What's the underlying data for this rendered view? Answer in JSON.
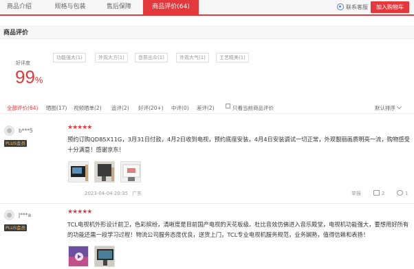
{
  "tabs": [
    {
      "label": "商品介绍"
    },
    {
      "label": "规格与包装"
    },
    {
      "label": "售后保障"
    },
    {
      "label": "商品评价(64)"
    }
  ],
  "header": {
    "service_label": "联系客服",
    "cart_label": "加入购物车"
  },
  "section_title": "商品评价",
  "rating": {
    "label": "好评度",
    "value": "99",
    "unit": "%"
  },
  "tags": [
    "功能强大(1)",
    "外观大方(1)",
    "音质出众(1)",
    "外观大气(1)",
    "工艺精美(1)"
  ],
  "filters": [
    "全部评价(64)",
    "晒图(17)",
    "视频晒单(2)",
    "追评(2)",
    "好评(20+)",
    "中评(0)",
    "差评(2)"
  ],
  "only_current_label": "只看当前商品评价",
  "sort_label": "默认排序",
  "reviews": [
    {
      "user": "b***5",
      "badge": "PLUS会员",
      "stars": "★★★★★",
      "text": "预约订购QD85X11G，3月31日付款，4月2日收到电视，预约底座安装，4月4日安装调试一切正常，外观靓丽画质明亮一流，购物感受十分满意！感谢京东！",
      "time": "2023-04-04 20:35",
      "location": "广东",
      "report_label": "举报",
      "likes": "2",
      "comments": "1"
    },
    {
      "user": "J***a",
      "badge": "PLUS会员",
      "stars": "★★★★★",
      "text": "TCL电视机外形设计前卫，色彩缤纷，清晰度是目前国产电视的天花板级。杜比音效仿佛进入音乐殿堂，电视机功能强大，要想用好所有的功能还需一段学习过程！物流公司服务态度优良，送货上门，TCL专业电视机服务规范，业务娴熟，值得信赖和表扬！"
    }
  ],
  "colors": {
    "accent": "#e4393c",
    "plus_badge_bg": "#3a3a3a",
    "plus_badge_text": "#f5c46a"
  }
}
